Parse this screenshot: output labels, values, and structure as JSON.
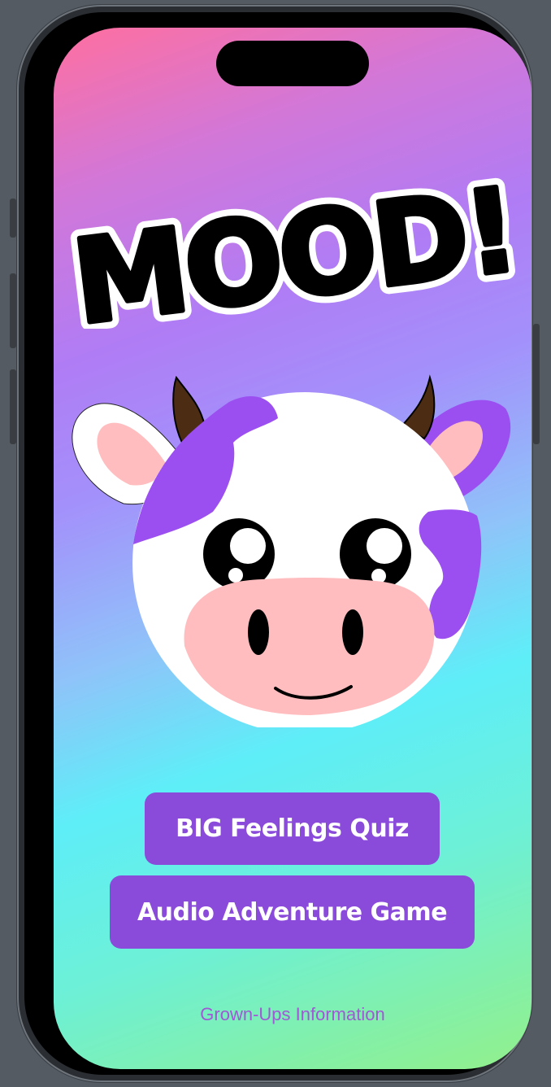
{
  "app": {
    "logo_text": "MOOD!"
  },
  "buttons": {
    "quiz_label": "BIG Feelings Quiz",
    "audio_label": "Audio Adventure Game"
  },
  "links": {
    "grown_ups_label": "Grown-Ups Information"
  },
  "colors": {
    "button_bg": "#8a4bdb",
    "link_text": "#a058d6",
    "cow_spot": "#9b4ff0",
    "cow_ear_inner": "#ffbdbf",
    "cow_horn": "#4d2c14"
  }
}
